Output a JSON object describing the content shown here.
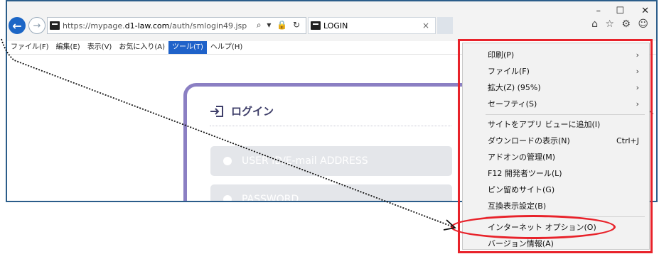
{
  "browser": {
    "url_prefix": "https://mypage.",
    "url_domain": "d1-law.com",
    "url_path": "/auth/smlogin49.jsp",
    "address_icons": "⌕ ▾ 🔒 ↻",
    "tab_title": "LOGIN",
    "tab_close": "×",
    "window_controls": {
      "minimize": "–",
      "maximize": "☐",
      "close": "✕"
    },
    "toolbar_icons": "⌂ ☆ ⚙ ☺"
  },
  "menubar": [
    {
      "label": "ファイル(F)"
    },
    {
      "label": "編集(E)"
    },
    {
      "label": "表示(V)"
    },
    {
      "label": "お気に入り(A)"
    },
    {
      "label": "ツール(T)"
    },
    {
      "label": "ヘルプ(H)"
    }
  ],
  "login": {
    "heading": "ログイン",
    "userid_placeholder": "USER ID/E-mail ADDRESS",
    "password_placeholder": "PASSWORD"
  },
  "context_menu": {
    "items": [
      {
        "label": "印刷(P)",
        "submenu": "›"
      },
      {
        "label": "ファイル(F)",
        "submenu": "›"
      },
      {
        "label": "拡大(Z) (95%)",
        "submenu": "›"
      },
      {
        "label": "セーフティ(S)",
        "submenu": "›"
      },
      {
        "label": "サイトをアプリ ビューに追加(I)"
      },
      {
        "label": "ダウンロードの表示(N)",
        "shortcut": "Ctrl+J"
      },
      {
        "label": "アドオンの管理(M)"
      },
      {
        "label": "F12 開発者ツール(L)"
      },
      {
        "label": "ピン留めサイト(G)"
      },
      {
        "label": "互換表示設定(B)"
      },
      {
        "label": "インターネット オプション(O)"
      },
      {
        "label": "バージョン情報(A)"
      }
    ]
  },
  "colors": {
    "highlight": "#e8222a",
    "active_menu": "#1f62c9",
    "card_border": "#8b7fc3"
  }
}
